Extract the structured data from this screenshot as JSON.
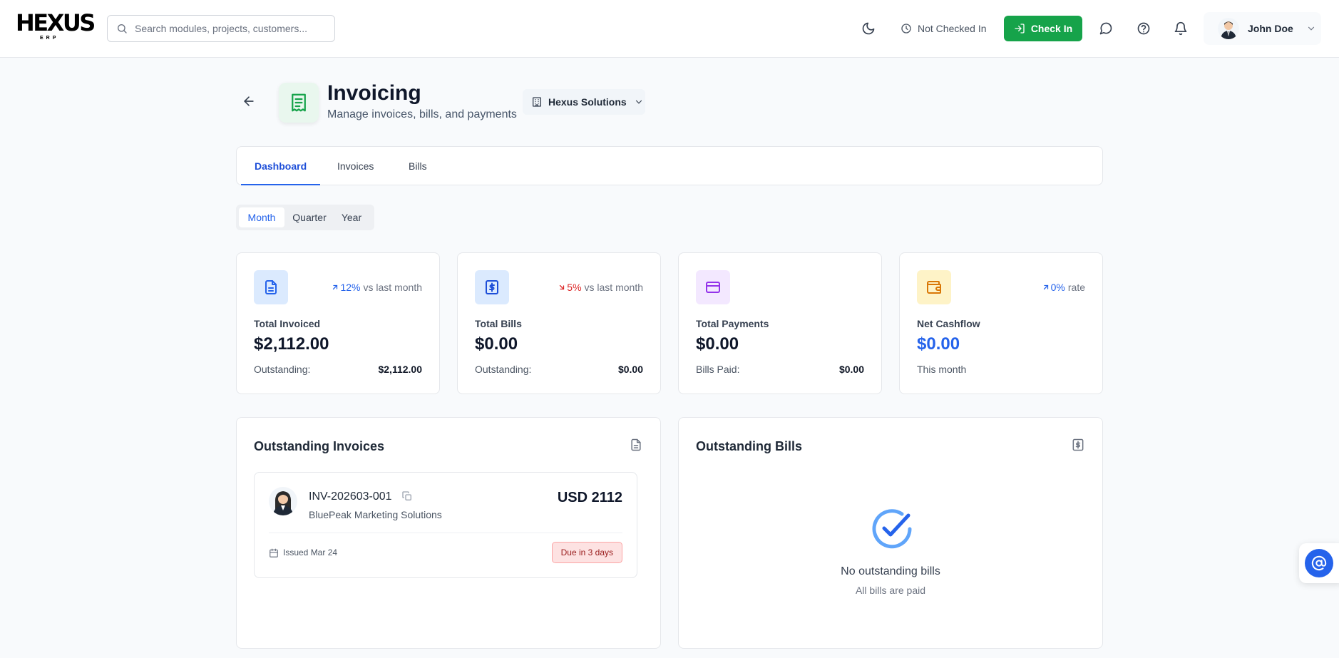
{
  "app": {
    "logo_text": "HEXUS",
    "logo_sub": "ERP"
  },
  "topbar": {
    "search_placeholder": "Search modules, projects, customers...",
    "status_text": "Not Checked In",
    "checkin_label": "Check In",
    "user_name": "John Doe",
    "icons": [
      "moon-icon",
      "clock-icon",
      "login-icon",
      "chat-icon",
      "help-icon",
      "bell-icon"
    ]
  },
  "header": {
    "title": "Invoicing",
    "subtitle": "Manage invoices, bills, and payments",
    "org_name": "Hexus Solutions"
  },
  "tabs": [
    {
      "label": "Dashboard",
      "active": true
    },
    {
      "label": "Invoices",
      "active": false
    },
    {
      "label": "Bills",
      "active": false
    }
  ],
  "period": {
    "options": [
      "Month",
      "Quarter",
      "Year"
    ],
    "selected": "Month"
  },
  "stats": [
    {
      "label": "Total Invoiced",
      "value": "$2,112.00",
      "trend_pct": "12%",
      "trend_text": "vs last month",
      "trend_dir": "up",
      "foot_label": "Outstanding:",
      "foot_value": "$2,112.00",
      "icon": "document-icon",
      "icon_bg": "#dbeafe",
      "icon_color": "#2563eb"
    },
    {
      "label": "Total Bills",
      "value": "$0.00",
      "trend_pct": "5%",
      "trend_text": "vs last month",
      "trend_dir": "down",
      "foot_label": "Outstanding:",
      "foot_value": "$0.00",
      "icon": "dollar-receipt-icon",
      "icon_bg": "#dbeafe",
      "icon_color": "#1d4ed8"
    },
    {
      "label": "Total Payments",
      "value": "$0.00",
      "trend_pct": "",
      "trend_text": "",
      "trend_dir": "",
      "foot_label": "Bills Paid:",
      "foot_value": "$0.00",
      "icon": "credit-card-icon",
      "icon_bg": "#f3e8ff",
      "icon_color": "#9333ea"
    },
    {
      "label": "Net Cashflow",
      "value": "$0.00",
      "trend_pct": "0%",
      "trend_text": "rate",
      "trend_dir": "up",
      "foot_label": "This month",
      "foot_value": "",
      "icon": "wallet-icon",
      "icon_bg": "#fef3c7",
      "icon_color": "#d97706"
    }
  ],
  "outstanding_invoices": {
    "title": "Outstanding Invoices",
    "items": [
      {
        "number": "INV-202603-001",
        "customer": "BluePeak Marketing Solutions",
        "amount": "USD 2112",
        "issued": "Issued Mar 24",
        "due": "Due in 3 days"
      }
    ]
  },
  "outstanding_bills": {
    "title": "Outstanding Bills",
    "empty_title": "No outstanding bills",
    "empty_subtitle": "All bills are paid"
  },
  "colors": {
    "primary": "#2563eb",
    "success": "#16a34a",
    "danger": "#dc2626"
  }
}
